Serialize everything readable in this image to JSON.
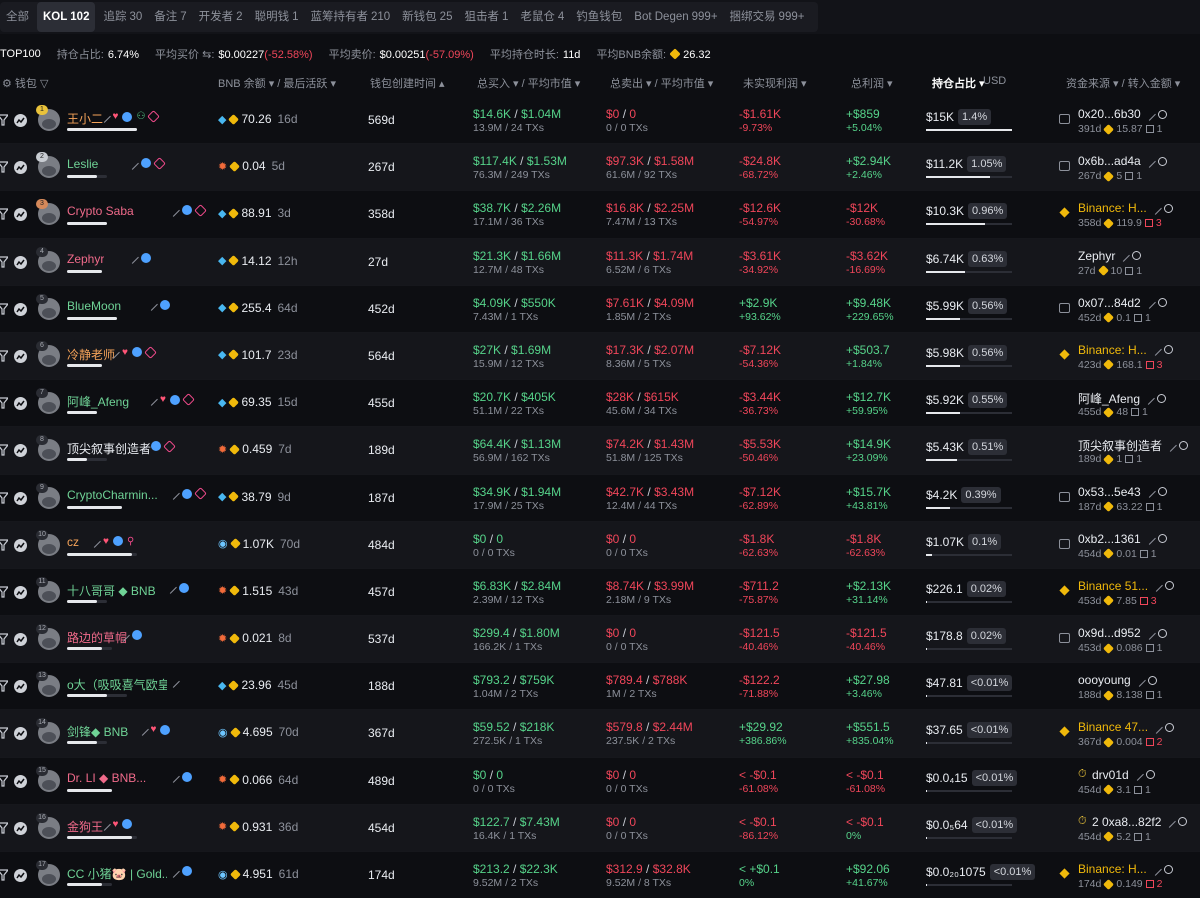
{
  "tabs": [
    {
      "label": "全部",
      "count": "",
      "active": false
    },
    {
      "label": "KOL",
      "count": "102",
      "active": true
    },
    {
      "label": "追踪",
      "count": "30",
      "active": false
    },
    {
      "label": "备注",
      "count": "7",
      "active": false
    },
    {
      "label": "开发者",
      "count": "2",
      "active": false
    },
    {
      "label": "聪明钱",
      "count": "1",
      "active": false
    },
    {
      "label": "蓝筹持有者",
      "count": "210",
      "active": false
    },
    {
      "label": "新钱包",
      "count": "25",
      "active": false
    },
    {
      "label": "狙击者",
      "count": "1",
      "active": false
    },
    {
      "label": "老鼠仓",
      "count": "4",
      "active": false
    },
    {
      "label": "钓鱼钱包",
      "count": "",
      "active": false
    },
    {
      "label": "Bot Degen",
      "count": "999+",
      "active": false
    },
    {
      "label": "捆绑交易",
      "count": "999+",
      "active": false
    }
  ],
  "stats": {
    "top_label": "TOP100",
    "hold_label": "持仓占比:",
    "hold_val": "6.74%",
    "avg_buy_label": "平均买价 ⇆:",
    "avg_buy_val": "$0.00227",
    "avg_buy_chg": "(-52.58%)",
    "avg_sell_label": "平均卖价:",
    "avg_sell_val": "$0.00251",
    "avg_sell_chg": "(-57.09%)",
    "avg_time_label": "平均持仓时长:",
    "avg_time_val": "11d",
    "avg_bnb_label": "平均BNB余额:",
    "avg_bnb_val": "26.32"
  },
  "header": {
    "wallet": "钱包",
    "bnb": "BNB 余额 ▾ / 最后活跃 ▾",
    "created": "钱包创建时间 ▴",
    "bought": "总买入 ▾ / 平均市值 ▾",
    "sold": "总卖出 ▾ / 平均市值 ▾",
    "unrealized": "未实现利润 ▾",
    "total_profit": "总利润 ▾",
    "holding": "持仓占比 ▾",
    "usd": "USD",
    "source": "资金来源 ▾ / 转入金额 ▾"
  },
  "rows": [
    {
      "rank": "1",
      "name": "王小二",
      "bal": "70.26",
      "last": "16d",
      "age": "569d",
      "buy": "$14.6K",
      "buy_mc": "$1.04M",
      "buy_sub": "13.9M / 24 TXs",
      "sell": "$0",
      "sell_mc": "0",
      "sell_sub": "0 / 0 TXs",
      "ur": "-$1.61K",
      "ur_p": "-9.73%",
      "tp": "+$859",
      "tp_p": "+5.04%",
      "usd": "$15K",
      "pct": "1.4%",
      "src": "0x20...6b30",
      "src_sub": "391d",
      "src_amt": "15.87",
      "src_cnt": "1"
    },
    {
      "rank": "2",
      "name": "Leslie",
      "bal": "0.04",
      "last": "5d",
      "age": "267d",
      "buy": "$117.4K",
      "buy_mc": "$1.53M",
      "buy_sub": "76.3M / 249 TXs",
      "sell": "$97.3K",
      "sell_mc": "$1.58M",
      "sell_sub": "61.6M / 92 TXs",
      "ur": "-$24.8K",
      "ur_p": "-68.72%",
      "tp": "+$2.94K",
      "tp_p": "+2.46%",
      "usd": "$11.2K",
      "pct": "1.05%",
      "src": "0x6b...ad4a",
      "src_sub": "267d",
      "src_amt": "5",
      "src_cnt": "1"
    },
    {
      "rank": "3",
      "name": "Crypto Saba",
      "bal": "88.91",
      "last": "3d",
      "age": "358d",
      "buy": "$38.7K",
      "buy_mc": "$2.26M",
      "buy_sub": "17.1M / 36 TXs",
      "sell": "$16.8K",
      "sell_mc": "$2.25M",
      "sell_sub": "7.47M / 13 TXs",
      "ur": "-$12.6K",
      "ur_p": "-54.97%",
      "tp": "-$12K",
      "tp_p": "-30.68%",
      "usd": "$10.3K",
      "pct": "0.96%",
      "src": "Binance: H...",
      "src_sub": "358d",
      "src_amt": "119.9",
      "src_cnt": "3"
    },
    {
      "rank": "4",
      "name": "Zephyr",
      "bal": "14.12",
      "last": "12h",
      "age": "27d",
      "buy": "$21.3K",
      "buy_mc": "$1.66M",
      "buy_sub": "12.7M / 48 TXs",
      "sell": "$11.3K",
      "sell_mc": "$1.74M",
      "sell_sub": "6.52M / 6 TXs",
      "ur": "-$3.61K",
      "ur_p": "-34.92%",
      "tp": "-$3.62K",
      "tp_p": "-16.69%",
      "usd": "$6.74K",
      "pct": "0.63%",
      "src": "Zephyr",
      "src_sub": "27d",
      "src_amt": "10",
      "src_cnt": "1"
    },
    {
      "rank": "5",
      "name": "BlueMoon",
      "bal": "255.4",
      "last": "64d",
      "age": "452d",
      "buy": "$4.09K",
      "buy_mc": "$550K",
      "buy_sub": "7.43M / 1 TXs",
      "sell": "$7.61K",
      "sell_mc": "$4.09M",
      "sell_sub": "1.85M / 2 TXs",
      "ur": "+$2.9K",
      "ur_p": "+93.62%",
      "tp": "+$9.48K",
      "tp_p": "+229.65%",
      "usd": "$5.99K",
      "pct": "0.56%",
      "src": "0x07...84d2",
      "src_sub": "452d",
      "src_amt": "0.1",
      "src_cnt": "1"
    },
    {
      "rank": "6",
      "name": "冷静老师",
      "bal": "101.7",
      "last": "23d",
      "age": "564d",
      "buy": "$27K",
      "buy_mc": "$1.69M",
      "buy_sub": "15.9M / 12 TXs",
      "sell": "$17.3K",
      "sell_mc": "$2.07M",
      "sell_sub": "8.36M / 5 TXs",
      "ur": "-$7.12K",
      "ur_p": "-54.36%",
      "tp": "+$503.7",
      "tp_p": "+1.84%",
      "usd": "$5.98K",
      "pct": "0.56%",
      "src": "Binance: H...",
      "src_sub": "423d",
      "src_amt": "168.1",
      "src_cnt": "3"
    },
    {
      "rank": "7",
      "name": "阿峰_Afeng",
      "bal": "69.35",
      "last": "15d",
      "age": "455d",
      "buy": "$20.7K",
      "buy_mc": "$405K",
      "buy_sub": "51.1M / 22 TXs",
      "sell": "$28K",
      "sell_mc": "$615K",
      "sell_sub": "45.6M / 34 TXs",
      "ur": "-$3.44K",
      "ur_p": "-36.73%",
      "tp": "+$12.7K",
      "tp_p": "+59.95%",
      "usd": "$5.92K",
      "pct": "0.55%",
      "src": "阿峰_Afeng",
      "src_sub": "455d",
      "src_amt": "48",
      "src_cnt": "1"
    },
    {
      "rank": "8",
      "name": "顶尖叙事创造者",
      "bal": "0.459",
      "last": "7d",
      "age": "189d",
      "buy": "$64.4K",
      "buy_mc": "$1.13M",
      "buy_sub": "56.9M / 162 TXs",
      "sell": "$74.2K",
      "sell_mc": "$1.43M",
      "sell_sub": "51.8M / 125 TXs",
      "ur": "-$5.53K",
      "ur_p": "-50.46%",
      "tp": "+$14.9K",
      "tp_p": "+23.09%",
      "usd": "$5.43K",
      "pct": "0.51%",
      "src": "顶尖叙事创造者",
      "src_sub": "189d",
      "src_amt": "1",
      "src_cnt": "1"
    },
    {
      "rank": "9",
      "name": "CryptoCharmin...",
      "bal": "38.79",
      "last": "9d",
      "age": "187d",
      "buy": "$34.9K",
      "buy_mc": "$1.94M",
      "buy_sub": "17.9M / 25 TXs",
      "sell": "$42.7K",
      "sell_mc": "$3.43M",
      "sell_sub": "12.4M / 44 TXs",
      "ur": "-$7.12K",
      "ur_p": "-62.89%",
      "tp": "+$15.7K",
      "tp_p": "+43.81%",
      "usd": "$4.2K",
      "pct": "0.39%",
      "src": "0x53...5e43",
      "src_sub": "187d",
      "src_amt": "63.22",
      "src_cnt": "1"
    },
    {
      "rank": "10",
      "name": "cz",
      "bal": "1.07K",
      "last": "70d",
      "age": "484d",
      "buy": "$0",
      "buy_mc": "0",
      "buy_sub": "0 / 0 TXs",
      "sell": "$0",
      "sell_mc": "0",
      "sell_sub": "0 / 0 TXs",
      "ur": "-$1.8K",
      "ur_p": "-62.63%",
      "tp": "-$1.8K",
      "tp_p": "-62.63%",
      "usd": "$1.07K",
      "pct": "0.1%",
      "src": "0xb2...1361",
      "src_sub": "454d",
      "src_amt": "0.01",
      "src_cnt": "1"
    },
    {
      "rank": "11",
      "name": "十八哥哥 ◆ BNB",
      "bal": "1.515",
      "last": "43d",
      "age": "457d",
      "buy": "$6.83K",
      "buy_mc": "$2.84M",
      "buy_sub": "2.39M / 12 TXs",
      "sell": "$8.74K",
      "sell_mc": "$3.99M",
      "sell_sub": "2.18M / 9 TXs",
      "ur": "-$711.2",
      "ur_p": "-75.87%",
      "tp": "+$2.13K",
      "tp_p": "+31.14%",
      "usd": "$226.1",
      "pct": "0.02%",
      "src": "Binance 51...",
      "src_sub": "453d",
      "src_amt": "7.85",
      "src_cnt": "3"
    },
    {
      "rank": "12",
      "name": "路边的草帽",
      "bal": "0.021",
      "last": "8d",
      "age": "537d",
      "buy": "$299.4",
      "buy_mc": "$1.80M",
      "buy_sub": "166.2K / 1 TXs",
      "sell": "$0",
      "sell_mc": "0",
      "sell_sub": "0 / 0 TXs",
      "ur": "-$121.5",
      "ur_p": "-40.46%",
      "tp": "-$121.5",
      "tp_p": "-40.46%",
      "usd": "$178.8",
      "pct": "0.02%",
      "src": "0x9d...d952",
      "src_sub": "453d",
      "src_amt": "0.086",
      "src_cnt": "1"
    },
    {
      "rank": "13",
      "name": "o大（吸吸喜气欧皇扫链版）",
      "bal": "23.96",
      "last": "45d",
      "age": "188d",
      "buy": "$793.2",
      "buy_mc": "$759K",
      "buy_sub": "1.04M / 2 TXs",
      "sell": "$789.4",
      "sell_mc": "$788K",
      "sell_sub": "1M / 2 TXs",
      "ur": "-$122.2",
      "ur_p": "-71.88%",
      "tp": "+$27.98",
      "tp_p": "+3.46%",
      "usd": "$47.81",
      "pct": "<0.01%",
      "src": "oooyoung",
      "src_sub": "188d",
      "src_amt": "8.138",
      "src_cnt": "1"
    },
    {
      "rank": "14",
      "name": "剑锋◆ BNB",
      "bal": "4.695",
      "last": "70d",
      "age": "367d",
      "buy": "$59.52",
      "buy_mc": "$218K",
      "buy_sub": "272.5K / 1 TXs",
      "sell": "$579.8",
      "sell_mc": "$2.44M",
      "sell_sub": "237.5K / 2 TXs",
      "ur": "+$29.92",
      "ur_p": "+386.86%",
      "tp": "+$551.5",
      "tp_p": "+835.04%",
      "usd": "$37.65",
      "pct": "<0.01%",
      "src": "Binance 47...",
      "src_sub": "367d",
      "src_amt": "0.004",
      "src_cnt": "2"
    },
    {
      "rank": "15",
      "name": "Dr. LI ◆ BNB...",
      "bal": "0.066",
      "last": "64d",
      "age": "489d",
      "buy": "$0",
      "buy_mc": "0",
      "buy_sub": "0 / 0 TXs",
      "sell": "$0",
      "sell_mc": "0",
      "sell_sub": "0 / 0 TXs",
      "ur": "< -$0.1",
      "ur_p": "-61.08%",
      "tp": "< -$0.1",
      "tp_p": "-61.08%",
      "usd": "$0.0₄15",
      "pct": "<0.01%",
      "src": "drv01d",
      "src_sub": "454d",
      "src_amt": "3.1",
      "src_cnt": "1"
    },
    {
      "rank": "16",
      "name": "金狗王",
      "bal": "0.931",
      "last": "36d",
      "age": "454d",
      "buy": "$122.7",
      "buy_mc": "$7.43M",
      "buy_sub": "16.4K / 1 TXs",
      "sell": "$0",
      "sell_mc": "0",
      "sell_sub": "0 / 0 TXs",
      "ur": "< -$0.1",
      "ur_p": "-86.12%",
      "tp": "< -$0.1",
      "tp_p": "0%",
      "usd": "$0.0₅64",
      "pct": "<0.01%",
      "src": "2 0xa8...82f2",
      "src_sub": "454d",
      "src_amt": "5.2",
      "src_cnt": "1"
    },
    {
      "rank": "17",
      "name": "CC 小猪🐷 | Gold...",
      "bal": "4.951",
      "last": "61d",
      "age": "174d",
      "buy": "$213.2",
      "buy_mc": "$22.3K",
      "buy_sub": "9.52M / 2 TXs",
      "sell": "$312.9",
      "sell_mc": "$32.8K",
      "sell_sub": "9.52M / 8 TXs",
      "ur": "< +$0.1",
      "ur_p": "0%",
      "tp": "+$92.06",
      "tp_p": "+41.67%",
      "usd": "$0.0₂₀1075",
      "pct": "<0.01%",
      "src": "Binance: H...",
      "src_sub": "174d",
      "src_amt": "0.149",
      "src_cnt": "2"
    }
  ]
}
